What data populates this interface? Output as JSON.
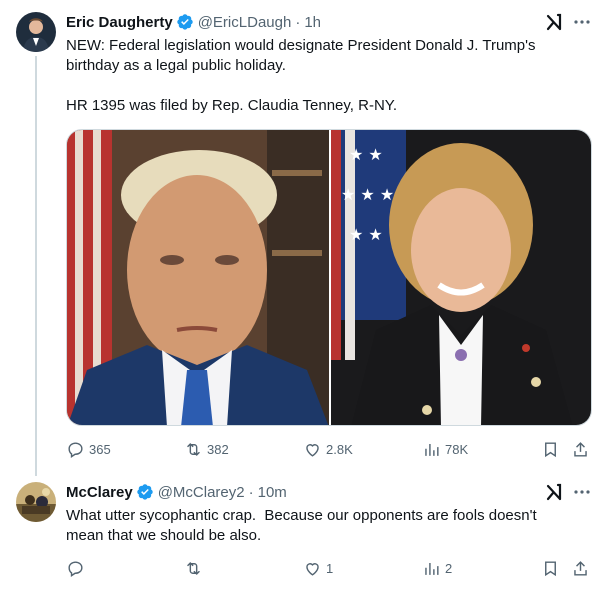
{
  "tweets": [
    {
      "author": {
        "name": "Eric Daugherty",
        "handle": "@EricLDaugh",
        "time": "1h"
      },
      "separator": "·",
      "text": "NEW: Federal legislation would designate President Donald J. Trump's birthday as a legal public holiday.\n\nHR 1395 was filed by Rep. Claudia Tenney, R-NY.",
      "stats": {
        "replies": "365",
        "reposts": "382",
        "likes": "2.8K",
        "views": "78K"
      }
    },
    {
      "author": {
        "name": "McClarey",
        "handle": "@McClarey2",
        "time": "10m"
      },
      "separator": "·",
      "text": "What utter sycophantic crap.  Because our opponents are fools doesn't mean that we should be also.",
      "stats": {
        "replies": "",
        "reposts": "",
        "likes": "1",
        "views": "2"
      }
    }
  ],
  "colors": {
    "text": "#0f1419",
    "secondary": "#536471",
    "verified": "#1d9bf0",
    "border": "#cfd9de"
  },
  "icons": [
    "verified-badge-icon",
    "grok-icon",
    "more-icon",
    "reply-icon",
    "repost-icon",
    "like-icon",
    "views-icon",
    "bookmark-icon",
    "share-icon"
  ]
}
